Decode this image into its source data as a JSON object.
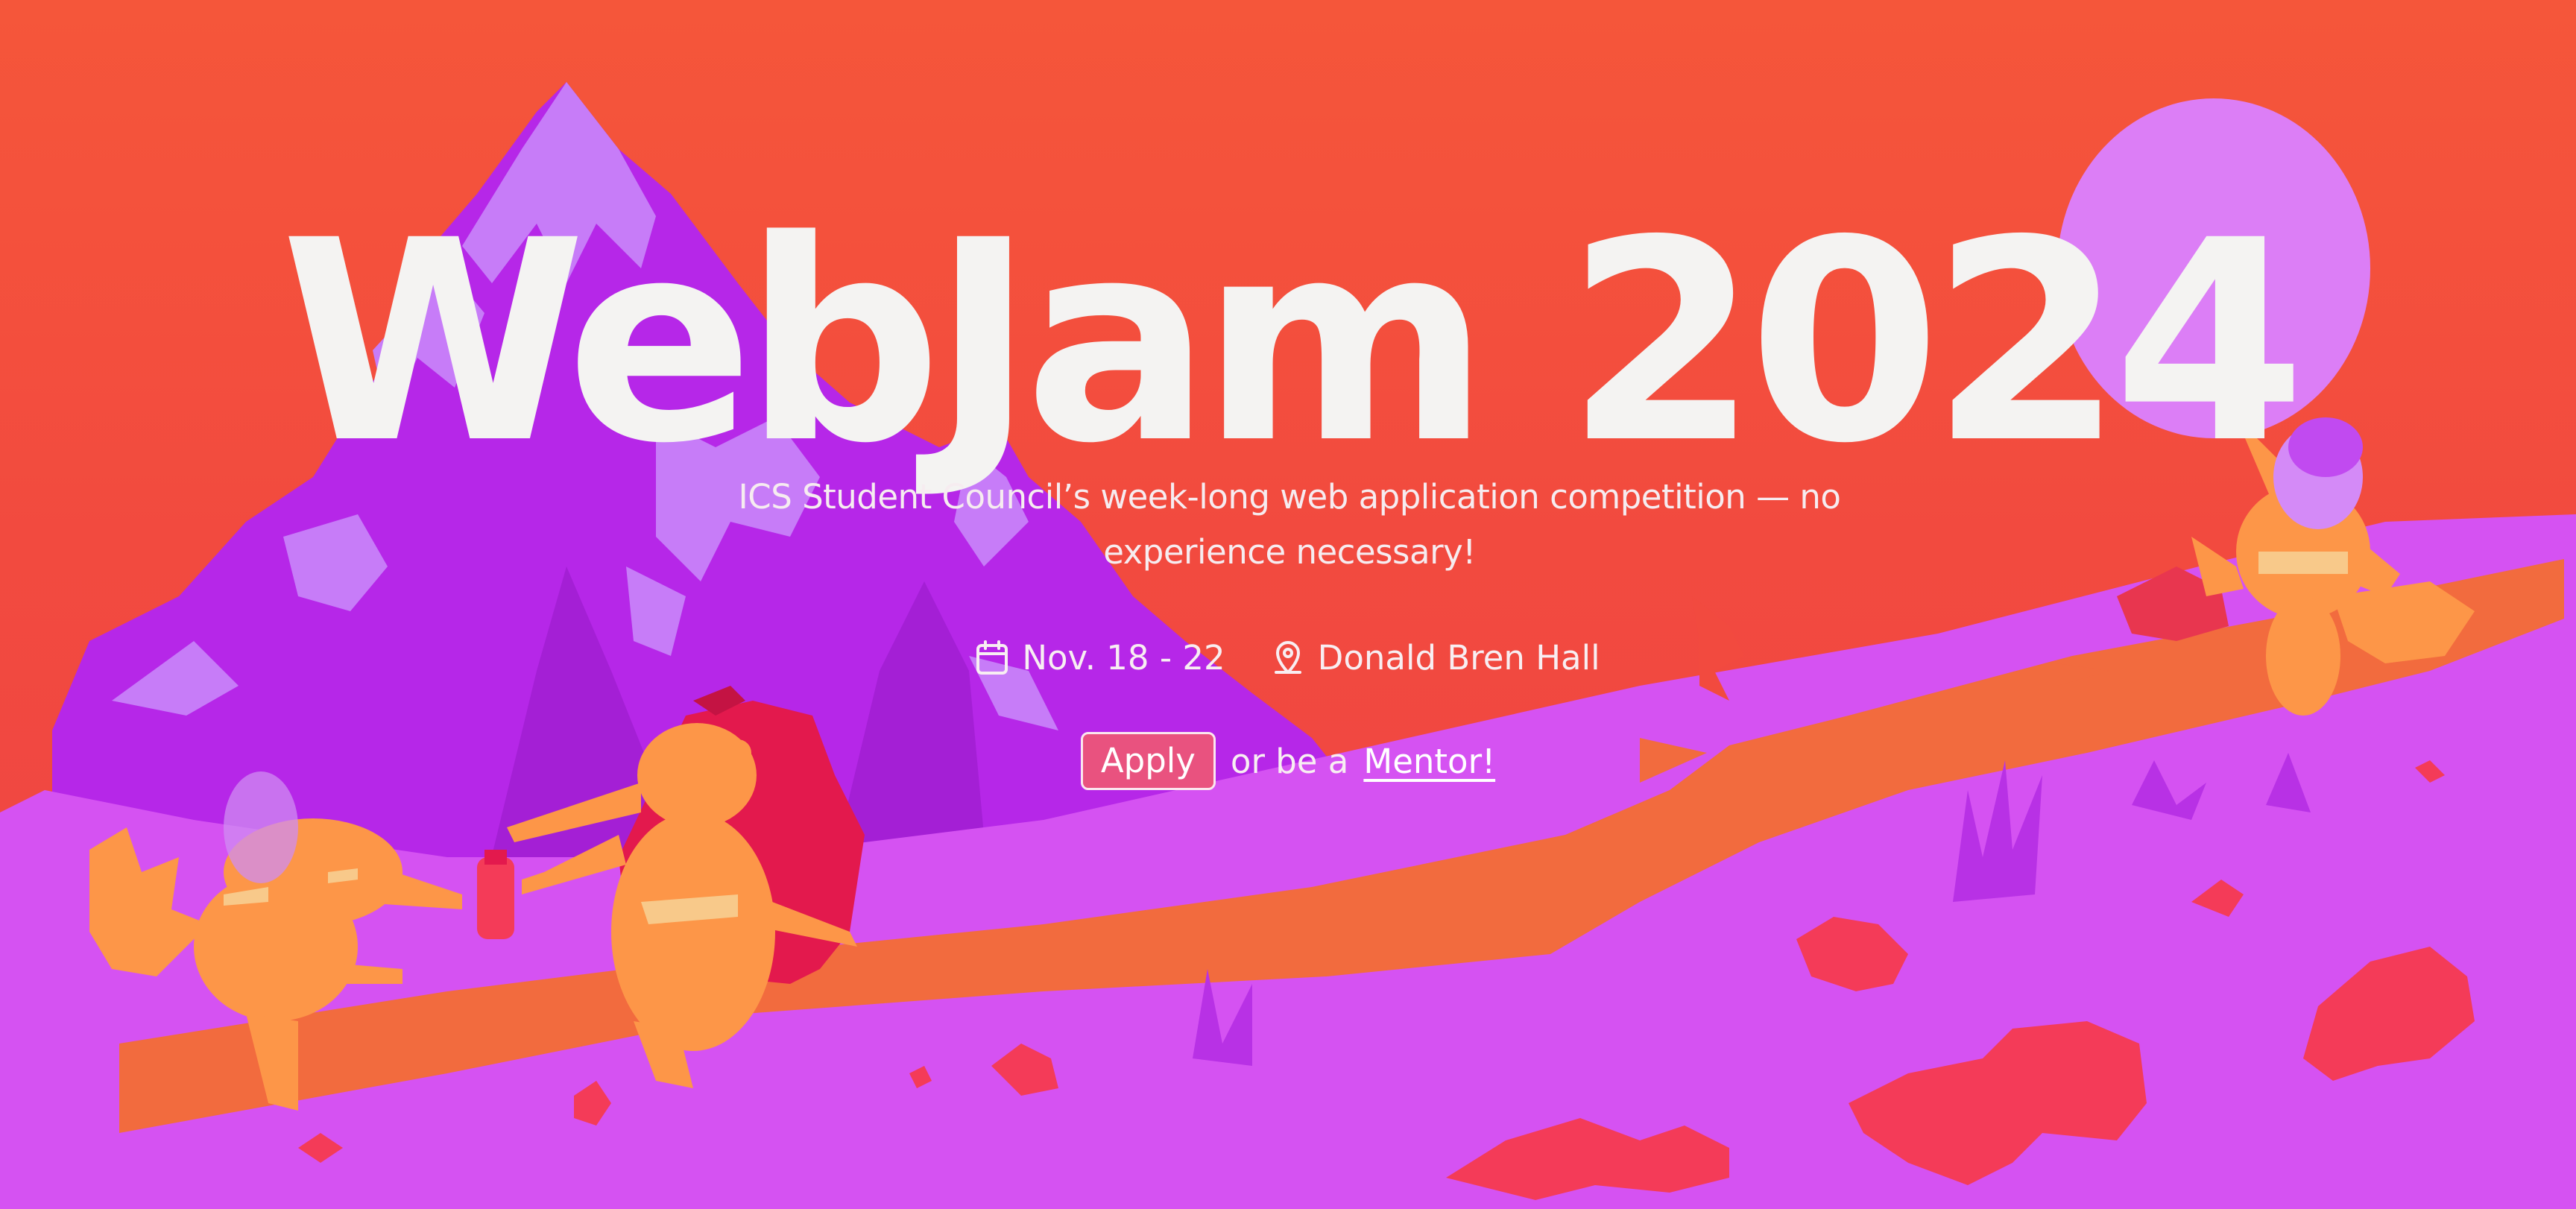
{
  "hero": {
    "title": "WebJam 2024",
    "tagline": "ICS Student Council’s week-long web application competition — no experience necessary!",
    "dates": "Nov. 18 - 22",
    "location": "Donald Bren Hall",
    "apply_label": "Apply",
    "connector_text": "or be a",
    "mentor_label": "Mentor!"
  },
  "icons": {
    "date": "calendar-icon",
    "location": "map-pin-icon"
  },
  "colors": {
    "sky": "#f4533a",
    "ground": "#d552f2",
    "mountain": "#b527e8",
    "mountain_highlight": "#c77cf8",
    "sun": "#dc7ef6",
    "path": "#f26b3e",
    "rocks": "#f43b58",
    "anteater": "#fd9648",
    "apply_button": "#e9527f",
    "text": "#f4f3f2"
  }
}
